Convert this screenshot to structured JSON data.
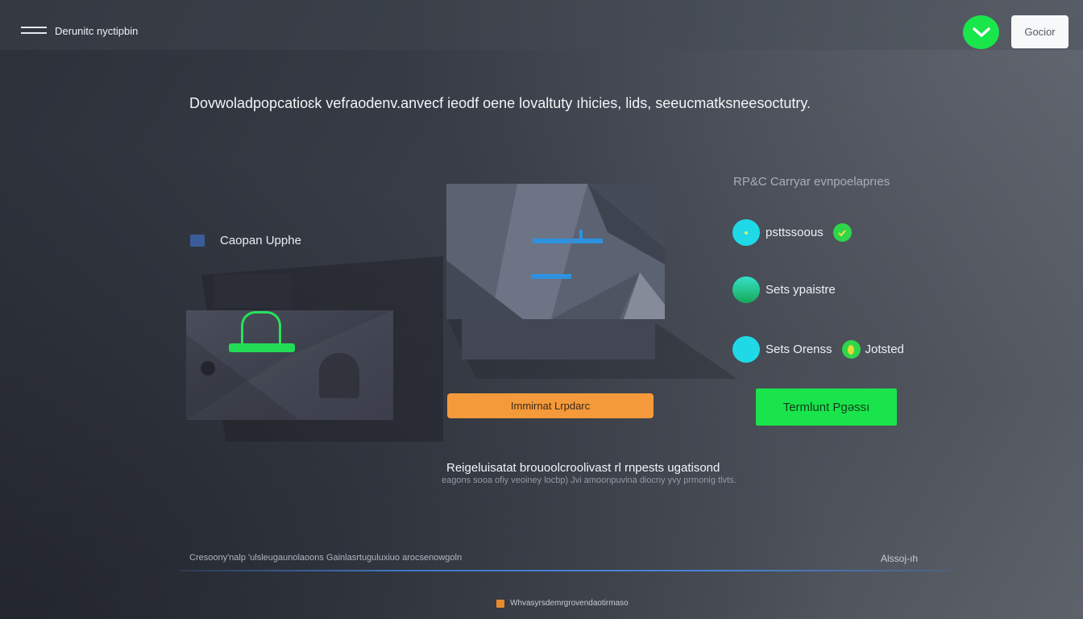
{
  "header": {
    "brand": "Derunitc nyctipbin",
    "sign_in": "Gocior"
  },
  "headline": "Dovwoladpopcatioɛk vefɾaodenv.anvecf ieodf oene lovaltuty ıhicies, lids, seeucmatksneesoctutry.",
  "left_panel": {
    "label": "Caopan Upphe"
  },
  "center": {
    "update_button": "Immirnat Lrpdarc"
  },
  "right_panel": {
    "title": "RP&C Carryar evnpoelaprıes",
    "items": [
      {
        "label": "psttssoous",
        "extra": ""
      },
      {
        "label": "Sets ypaistre",
        "extra": ""
      },
      {
        "label": "Sets Orenss",
        "extra": "Jotsted"
      }
    ],
    "action_button": "Termlunt Pgəssı"
  },
  "note": {
    "title": "Reigeluisatat brouoolcroolivast rl rnpests ugatisond",
    "subtitle": "eagons sooa ofiy veoiney locbp) Jvi amoonpuvina diocny yvy prmonig tlvts."
  },
  "footer": {
    "left_text": "Cresoony'nalp  'ulsleugaunolaoons Gainlasrtuguluxiuo arocsenowgoln",
    "right_text": "Alssoj-ıh",
    "bottom_note": "Whvasyrsdemrgrovendaotirmaso"
  },
  "colors": {
    "accent_green": "#19e64a",
    "accent_orange": "#f59a3b",
    "accent_cyan": "#1fd9e6",
    "progress_blue": "#2c92e0"
  }
}
